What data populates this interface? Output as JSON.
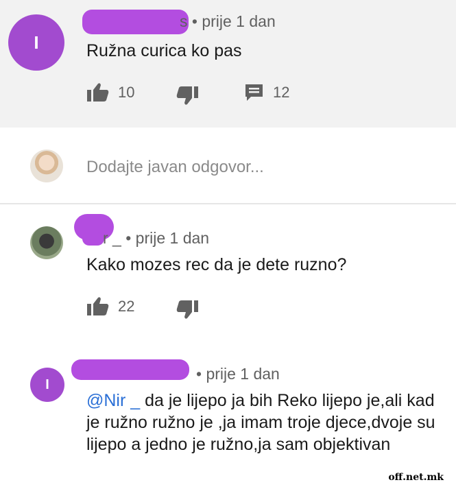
{
  "top_comment": {
    "avatar_letter": "I",
    "author_fragment": "s",
    "time": "• prije 1 dan",
    "text": "Ružna curica ko pas",
    "likes": "10",
    "replies": "12"
  },
  "reply_box": {
    "placeholder": "Dodajte javan odgovor..."
  },
  "reply_1": {
    "author_fragment": "r _",
    "time": "• prije 1 dan",
    "text": "Kako mozes rec da je dete ruzno?",
    "likes": "22"
  },
  "reply_2": {
    "avatar_letter": "I",
    "time": "• prije 1 dan",
    "mention": "@Nir _",
    "text": " da je lijepo ja bih Reko lijepo je,ali kad je ružno ružno je ,ja imam troje djece,dvoje su lijepo a jedno je ružno,ja sam objektivan"
  },
  "watermark": "off.net.mk",
  "colors": {
    "redaction": "#b34de0",
    "avatar": "#a24bcf",
    "mention": "#2a6fd6"
  },
  "icons": [
    "thumb-up-icon",
    "thumb-down-icon",
    "comment-icon"
  ]
}
